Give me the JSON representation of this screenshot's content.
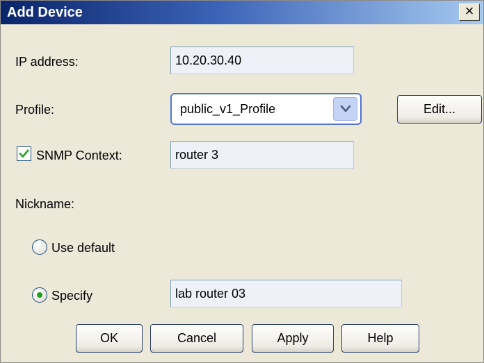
{
  "dialog": {
    "title": "Add Device",
    "close_label": "×"
  },
  "form": {
    "ip_label": "IP address:",
    "ip_value": "10.20.30.40",
    "profile_label": "Profile:",
    "profile_selected": "public_v1_Profile",
    "edit_label": "Edit...",
    "snmp_checked": true,
    "snmp_label": "SNMP Context:",
    "snmp_value": "router 3",
    "nickname_label": "Nickname:",
    "use_default_label": "Use default",
    "specify_label": "Specify",
    "nickname_choice": "Specify",
    "nickname_value": "lab router 03"
  },
  "buttons": {
    "ok": "OK",
    "cancel": "Cancel",
    "apply": "Apply",
    "help": "Help"
  },
  "icons": {
    "close": "close-icon",
    "dropdown": "chevron-down-icon",
    "checkbox": "checkmark-icon"
  },
  "colors": {
    "title_gradient_start": "#0a246a",
    "title_gradient_end": "#a6caf0",
    "dialog_background": "#ece9d8",
    "check_green": "#21a121"
  }
}
